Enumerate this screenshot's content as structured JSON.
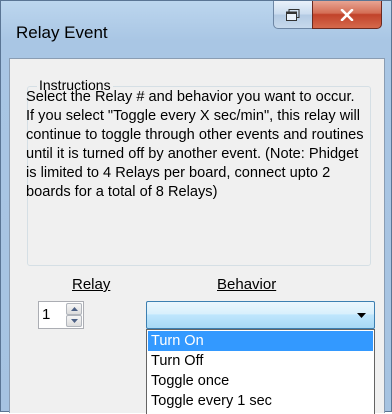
{
  "window": {
    "title": "Relay Event"
  },
  "instructions": {
    "legend": "Instructions",
    "text": "Select the Relay # and behavior you want to occur. If you select \"Toggle every X sec/min\", this relay will continue to toggle through other events and routines until it is turned off by another event. (Note: Phidget is limited to 4 Relays per board, connect upto 2 boards for a total of 8 Relays)"
  },
  "relay": {
    "label": "Relay",
    "value": "1"
  },
  "behavior": {
    "label": "Behavior",
    "selected": "",
    "options": [
      "Turn On",
      "Turn Off",
      "Toggle once",
      "Toggle every 1 sec"
    ],
    "highlighted_index": 0
  },
  "colors": {
    "highlight": "#3399ff",
    "close_button": "#c1422a"
  },
  "icons": {
    "restore": "restore-icon",
    "close": "close-icon",
    "spin_up": "chevron-up-icon",
    "spin_down": "chevron-down-icon",
    "combo_arrow": "dropdown-arrow-icon"
  }
}
